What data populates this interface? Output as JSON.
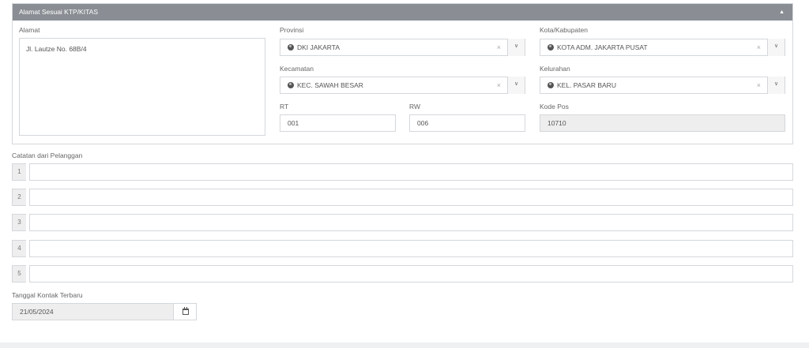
{
  "panel": {
    "title": "Alamat Sesuai KTP/KITAS",
    "collapse_icon": "caret-up-icon",
    "address_label": "Alamat",
    "address_value": "Jl. Lautze No. 68B/4",
    "province": {
      "label": "Provinsi",
      "value": "DKI JAKARTA",
      "clear": "×",
      "icon": "globe-icon"
    },
    "city": {
      "label": "Kota/Kabupaten",
      "value": "KOTA ADM. JAKARTA PUSAT",
      "clear": "×",
      "icon": "globe-icon"
    },
    "district": {
      "label": "Kecamatan",
      "value": "KEC. SAWAH BESAR",
      "clear": "×",
      "icon": "globe-icon"
    },
    "subdistrict": {
      "label": "Kelurahan",
      "value": "KEL. PASAR BARU",
      "clear": "×",
      "icon": "globe-icon"
    },
    "rt": {
      "label": "RT",
      "value": "001"
    },
    "rw": {
      "label": "RW",
      "value": "006"
    },
    "postal": {
      "label": "Kode Pos",
      "value": "10710"
    }
  },
  "notes": {
    "label": "Catatan dari Pelanggan",
    "rows": [
      {
        "num": "1",
        "value": ""
      },
      {
        "num": "2",
        "value": ""
      },
      {
        "num": "3",
        "value": ""
      },
      {
        "num": "4",
        "value": ""
      },
      {
        "num": "5",
        "value": ""
      }
    ]
  },
  "last_contact": {
    "label": "Tanggal Kontak Terbaru",
    "value": "21/05/2024",
    "icon": "calendar-icon"
  }
}
